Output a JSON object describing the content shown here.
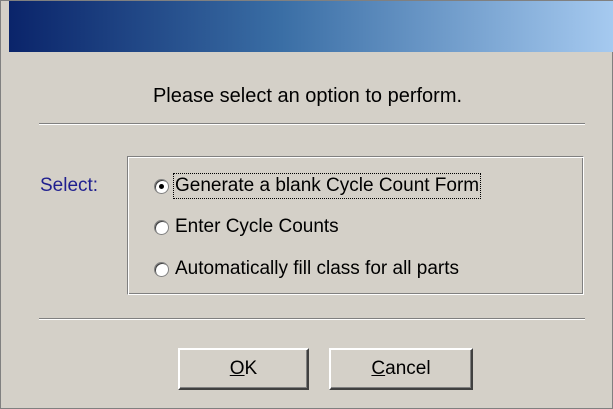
{
  "dialog": {
    "prompt": "Please select an option to perform.",
    "select_label": "Select:",
    "options": [
      {
        "label": "Generate a blank Cycle Count Form",
        "selected": true
      },
      {
        "label": "Enter Cycle Counts",
        "selected": false
      },
      {
        "label": "Automatically fill class for all parts",
        "selected": false
      }
    ],
    "ok": {
      "mnemonic": "O",
      "rest": "K"
    },
    "cancel": {
      "mnemonic": "C",
      "rest": "ancel"
    }
  },
  "colors": {
    "title_gradient_start": "#0a246a",
    "title_gradient_end": "#a6caf0",
    "select_label": "#1f1f8f",
    "face": "#d4d0c8"
  }
}
